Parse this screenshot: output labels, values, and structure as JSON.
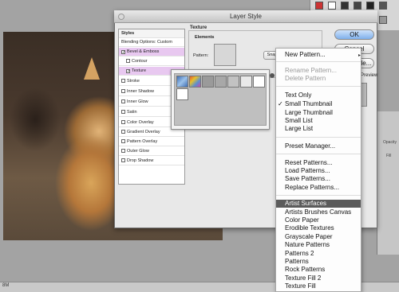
{
  "window": {
    "title": "Layer Style"
  },
  "styles_panel": {
    "header": "Styles",
    "blending_options": "Blending Options: Custom",
    "items": [
      {
        "label": "Bevel & Emboss",
        "checked": true,
        "selected": true
      },
      {
        "label": "Contour",
        "checked": false,
        "selected": false
      },
      {
        "label": "Texture",
        "checked": true,
        "selected": true
      },
      {
        "label": "Stroke",
        "checked": false,
        "selected": false
      },
      {
        "label": "Inner Shadow",
        "checked": false,
        "selected": false
      },
      {
        "label": "Inner Glow",
        "checked": false,
        "selected": false
      },
      {
        "label": "Satin",
        "checked": false,
        "selected": false
      },
      {
        "label": "Color Overlay",
        "checked": false,
        "selected": false
      },
      {
        "label": "Gradient Overlay",
        "checked": false,
        "selected": false
      },
      {
        "label": "Pattern Overlay",
        "checked": false,
        "selected": false
      },
      {
        "label": "Outer Glow",
        "checked": false,
        "selected": false
      },
      {
        "label": "Drop Shadow",
        "checked": false,
        "selected": false
      }
    ]
  },
  "texture": {
    "group_label": "Texture",
    "elements_label": "Elements",
    "pattern_label": "Pattern:",
    "snap_button": "Snap"
  },
  "buttons": {
    "ok": "OK",
    "cancel": "Cancel",
    "new_style": "New Style...",
    "preview": "Preview"
  },
  "menu": {
    "items": [
      {
        "label": "New Pattern...",
        "disabled": false,
        "checked": false,
        "highlighted": false
      },
      {
        "label": "Rename Pattern...",
        "disabled": true,
        "checked": false,
        "highlighted": false
      },
      {
        "label": "Delete Pattern",
        "disabled": true,
        "checked": false,
        "highlighted": false
      },
      {
        "label": "Text Only",
        "disabled": false,
        "checked": false,
        "highlighted": false
      },
      {
        "label": "Small Thumbnail",
        "disabled": false,
        "checked": true,
        "highlighted": false
      },
      {
        "label": "Large Thumbnail",
        "disabled": false,
        "checked": false,
        "highlighted": false
      },
      {
        "label": "Small List",
        "disabled": false,
        "checked": false,
        "highlighted": false
      },
      {
        "label": "Large List",
        "disabled": false,
        "checked": false,
        "highlighted": false
      },
      {
        "label": "Preset Manager...",
        "disabled": false,
        "checked": false,
        "highlighted": false
      },
      {
        "label": "Reset Patterns...",
        "disabled": false,
        "checked": false,
        "highlighted": false
      },
      {
        "label": "Load Patterns...",
        "disabled": false,
        "checked": false,
        "highlighted": false
      },
      {
        "label": "Save Patterns...",
        "disabled": false,
        "checked": false,
        "highlighted": false
      },
      {
        "label": "Replace Patterns...",
        "disabled": false,
        "checked": false,
        "highlighted": false
      },
      {
        "label": "Artist Surfaces",
        "disabled": false,
        "checked": false,
        "highlighted": true
      },
      {
        "label": "Artists Brushes Canvas",
        "disabled": false,
        "checked": false,
        "highlighted": false
      },
      {
        "label": "Color Paper",
        "disabled": false,
        "checked": false,
        "highlighted": false
      },
      {
        "label": "Erodible Textures",
        "disabled": false,
        "checked": false,
        "highlighted": false
      },
      {
        "label": "Grayscale Paper",
        "disabled": false,
        "checked": false,
        "highlighted": false
      },
      {
        "label": "Nature Patterns",
        "disabled": false,
        "checked": false,
        "highlighted": false
      },
      {
        "label": "Patterns 2",
        "disabled": false,
        "checked": false,
        "highlighted": false
      },
      {
        "label": "Patterns",
        "disabled": false,
        "checked": false,
        "highlighted": false
      },
      {
        "label": "Rock Patterns",
        "disabled": false,
        "checked": false,
        "highlighted": false
      },
      {
        "label": "Texture Fill 2",
        "disabled": false,
        "checked": false,
        "highlighted": false
      },
      {
        "label": "Texture Fill",
        "disabled": false,
        "checked": false,
        "highlighted": false
      }
    ],
    "check_glyph": "✓"
  },
  "right_panel": {
    "opacity_label": "Opacity",
    "fill_label": "Fill"
  },
  "status": {
    "text": "8M"
  },
  "colors": {
    "selection_pink": "#e8c8f0",
    "menu_highlight": "#5b5b5b",
    "default_button": "#7fb0ec"
  }
}
